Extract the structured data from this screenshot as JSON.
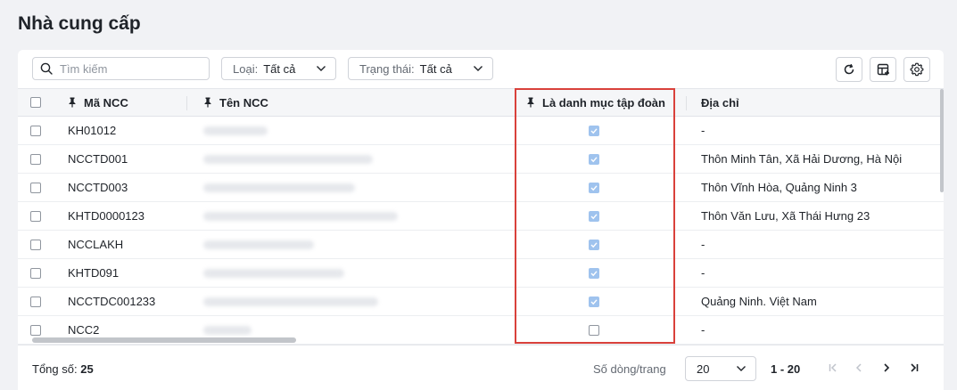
{
  "page": {
    "title": "Nhà cung cấp"
  },
  "toolbar": {
    "search_placeholder": "Tìm kiếm",
    "filter_type": {
      "label": "Loại:",
      "value": "Tất cả"
    },
    "filter_status": {
      "label": "Trạng thái:",
      "value": "Tất cả"
    },
    "icons": [
      "refresh-icon",
      "column-settings-icon",
      "gear-icon"
    ]
  },
  "table": {
    "columns": {
      "code": "Mã NCC",
      "name": "Tên NCC",
      "is_group_catalog": "Là danh mục tập đoàn",
      "address": "Địa chỉ"
    },
    "rows": [
      {
        "code": "KH01012",
        "group": true,
        "address": "-"
      },
      {
        "code": "NCCTD001",
        "group": true,
        "address": "Thôn Minh Tân, Xã Hải Dương, Hà Nội"
      },
      {
        "code": "NCCTD003",
        "group": true,
        "address": "Thôn Vĩnh Hòa, Quảng Ninh 3"
      },
      {
        "code": "KHTD0000123",
        "group": true,
        "address": "Thôn Văn Lưu, Xã Thái Hưng 23"
      },
      {
        "code": "NCCLAKH",
        "group": true,
        "address": "-"
      },
      {
        "code": "KHTD091",
        "group": true,
        "address": "-"
      },
      {
        "code": "NCCTDC001233",
        "group": true,
        "address": "Quảng Ninh. Việt Nam"
      },
      {
        "code": "NCC2",
        "group": false,
        "address": "-"
      }
    ]
  },
  "footer": {
    "total_label": "Tổng số:",
    "total_value": "25",
    "rows_per_page_label": "Số dòng/trang",
    "page_size": "20",
    "range": "1 - 20"
  },
  "colors": {
    "highlight": "#d9413b",
    "checkbox_checked": "#9fc3ee"
  }
}
